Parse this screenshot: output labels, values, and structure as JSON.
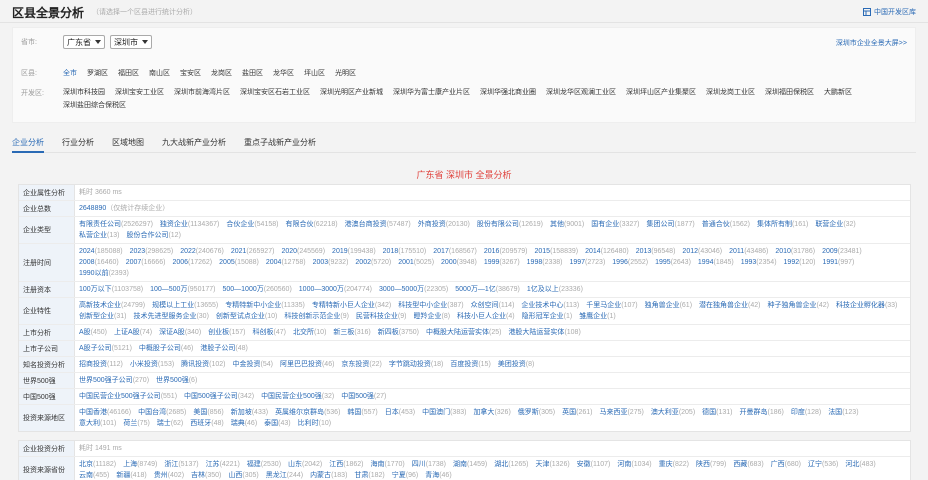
{
  "header": {
    "title": "区县全景分析",
    "subtitle": "（请选择一个区县进行统计分析）",
    "right_link": "中国开发区库"
  },
  "filter": {
    "province_label": "省市:",
    "province_value": "广东省",
    "city_value": "深圳市",
    "big_screen_link": "深圳市企业全景大屏>>",
    "district_label": "区县:",
    "districts": [
      "全市",
      "罗湖区",
      "福田区",
      "南山区",
      "宝安区",
      "龙岗区",
      "盐田区",
      "龙华区",
      "坪山区",
      "光明区"
    ],
    "zone_label": "开发区:",
    "zones": [
      "深圳市科技园",
      "深圳宝安工业区",
      "深圳市前海湾片区",
      "深圳宝安区石岩工业区",
      "深圳光明区产业新城",
      "深圳华为富士康产业片区",
      "深圳华强北商业圈",
      "深圳龙华区观澜工业区",
      "深圳坪山区产业集聚区",
      "深圳龙岗工业区",
      "深圳福田保税区",
      "大鹏新区",
      "深圳盐田综合保税区"
    ]
  },
  "tabs": [
    "企业分析",
    "行业分析",
    "区域地图",
    "九大战新产业分析",
    "重点子战新产业分析"
  ],
  "main_title": "广东省 深圳市 全景分析",
  "table1": {
    "rows": [
      {
        "label": "企业属性分析",
        "plain": "耗时 3660 ms",
        "items": []
      },
      {
        "label": "企业总数",
        "plain": "",
        "items": [
          {
            "t": "2648890",
            "c": "（仅统计存续企业）"
          }
        ]
      },
      {
        "label": "企业类型",
        "plain": "",
        "items": [
          {
            "t": "有限责任公司",
            "c": "(2526297)"
          },
          {
            "t": "独资企业",
            "c": "(1134367)"
          },
          {
            "t": "合伙企业",
            "c": "(54158)"
          },
          {
            "t": "有限合伙",
            "c": "(62218)"
          },
          {
            "t": "港澳台商投资",
            "c": "(57487)"
          },
          {
            "t": "外商投资",
            "c": "(20130)"
          },
          {
            "t": "股份有限公司",
            "c": "(12619)"
          },
          {
            "t": "其他",
            "c": "(9001)"
          },
          {
            "t": "国有企业",
            "c": "(3327)"
          },
          {
            "t": "集团公司",
            "c": "(1877)"
          },
          {
            "t": "普通合伙",
            "c": "(1562)"
          },
          {
            "t": "集体所有制",
            "c": "(161)"
          },
          {
            "t": "联营企业",
            "c": "(32)"
          },
          {
            "t": "私营企业",
            "c": "(13)"
          },
          {
            "t": "股份合作公司",
            "c": "(12)"
          }
        ]
      },
      {
        "label": "注册时间",
        "plain": "",
        "items": [
          {
            "t": "2024",
            "c": "(185088)"
          },
          {
            "t": "2023",
            "c": "(298625)"
          },
          {
            "t": "2022",
            "c": "(240676)"
          },
          {
            "t": "2021",
            "c": "(265927)"
          },
          {
            "t": "2020",
            "c": "(245569)"
          },
          {
            "t": "2019",
            "c": "(199438)"
          },
          {
            "t": "2018",
            "c": "(175510)"
          },
          {
            "t": "2017",
            "c": "(168567)"
          },
          {
            "t": "2016",
            "c": "(209579)"
          },
          {
            "t": "2015",
            "c": "(158839)"
          },
          {
            "t": "2014",
            "c": "(126480)"
          },
          {
            "t": "2013",
            "c": "(96548)"
          },
          {
            "t": "2012",
            "c": "(43046)"
          },
          {
            "t": "2011",
            "c": "(43486)"
          },
          {
            "t": "2010",
            "c": "(31786)"
          },
          {
            "t": "2009",
            "c": "(23481)"
          },
          {
            "t": "2008",
            "c": "(16460)"
          },
          {
            "t": "2007",
            "c": "(16666)"
          },
          {
            "t": "2006",
            "c": "(17262)"
          },
          {
            "t": "2005",
            "c": "(15088)"
          },
          {
            "t": "2004",
            "c": "(12758)"
          },
          {
            "t": "2003",
            "c": "(9232)"
          },
          {
            "t": "2002",
            "c": "(5720)"
          },
          {
            "t": "2001",
            "c": "(5025)"
          },
          {
            "t": "2000",
            "c": "(3948)"
          },
          {
            "t": "1999",
            "c": "(3267)"
          },
          {
            "t": "1998",
            "c": "(2338)"
          },
          {
            "t": "1997",
            "c": "(2723)"
          },
          {
            "t": "1996",
            "c": "(2552)"
          },
          {
            "t": "1995",
            "c": "(2643)"
          },
          {
            "t": "1994",
            "c": "(1845)"
          },
          {
            "t": "1993",
            "c": "(2354)"
          },
          {
            "t": "1992",
            "c": "(120)"
          },
          {
            "t": "1991",
            "c": "(997)"
          },
          {
            "t": "1990以前",
            "c": "(2393)"
          }
        ]
      },
      {
        "label": "注册资本",
        "plain": "",
        "items": [
          {
            "t": "100万以下",
            "c": "(1103758)"
          },
          {
            "t": "100—500万",
            "c": "(950177)"
          },
          {
            "t": "500—1000万",
            "c": "(260560)"
          },
          {
            "t": "1000—3000万",
            "c": "(204774)"
          },
          {
            "t": "3000—5000万",
            "c": "(22305)"
          },
          {
            "t": "5000万—1亿",
            "c": "(38679)"
          },
          {
            "t": "1亿及以上",
            "c": "(23336)"
          }
        ]
      },
      {
        "label": "企业特性",
        "plain": "",
        "items": [
          {
            "t": "高新技术企业",
            "c": "(24799)"
          },
          {
            "t": "规模以上工业",
            "c": "(13655)"
          },
          {
            "t": "专精特新中小企业",
            "c": "(11335)"
          },
          {
            "t": "专精特新小巨人企业",
            "c": "(342)"
          },
          {
            "t": "科技型中小企业",
            "c": "(387)"
          },
          {
            "t": "众创空间",
            "c": "(114)"
          },
          {
            "t": "企业技术中心",
            "c": "(113)"
          },
          {
            "t": "千里马企业",
            "c": "(107)"
          },
          {
            "t": "独角兽企业",
            "c": "(61)"
          },
          {
            "t": "潜在独角兽企业",
            "c": "(42)"
          },
          {
            "t": "种子独角兽企业",
            "c": "(42)"
          },
          {
            "t": "科技企业孵化器",
            "c": "(33)"
          },
          {
            "t": "创新型企业",
            "c": "(31)"
          },
          {
            "t": "技术先进型服务企业",
            "c": "(30)"
          },
          {
            "t": "创新型试点企业",
            "c": "(10)"
          },
          {
            "t": "科技创新示范企业",
            "c": "(9)"
          },
          {
            "t": "民营科技企业",
            "c": "(9)"
          },
          {
            "t": "瞪羚企业",
            "c": "(8)"
          },
          {
            "t": "科技小巨人企业",
            "c": "(4)"
          },
          {
            "t": "隐形冠军企业",
            "c": "(1)"
          },
          {
            "t": "雏鹰企业",
            "c": "(1)"
          }
        ]
      },
      {
        "label": "上市分析",
        "plain": "",
        "items": [
          {
            "t": "A股",
            "c": "(450)"
          },
          {
            "t": "上证A股",
            "c": "(74)"
          },
          {
            "t": "深证A股",
            "c": "(340)"
          },
          {
            "t": "创业板",
            "c": "(157)"
          },
          {
            "t": "科创板",
            "c": "(47)"
          },
          {
            "t": "北交所",
            "c": "(10)"
          },
          {
            "t": "新三板",
            "c": "(316)"
          },
          {
            "t": "新四板",
            "c": "(3750)"
          },
          {
            "t": "中概股大陆运营实体",
            "c": "(25)"
          },
          {
            "t": "港股大陆运营实体",
            "c": "(108)"
          }
        ]
      },
      {
        "label": "上市子公司",
        "plain": "",
        "items": [
          {
            "t": "A股子公司",
            "c": "(5121)"
          },
          {
            "t": "中概股子公司",
            "c": "(46)"
          },
          {
            "t": "港股子公司",
            "c": "(48)"
          }
        ]
      },
      {
        "label": "知名投资分析",
        "plain": "",
        "items": [
          {
            "t": "招商投资",
            "c": "(112)"
          },
          {
            "t": "小米投资",
            "c": "(153)"
          },
          {
            "t": "腾讯投资",
            "c": "(102)"
          },
          {
            "t": "中金投资",
            "c": "(54)"
          },
          {
            "t": "阿里巴巴投资",
            "c": "(46)"
          },
          {
            "t": "京东投资",
            "c": "(22)"
          },
          {
            "t": "字节跳动投资",
            "c": "(18)"
          },
          {
            "t": "百度投资",
            "c": "(15)"
          },
          {
            "t": "美团投资",
            "c": "(8)"
          }
        ]
      },
      {
        "label": "世界500强",
        "plain": "",
        "items": [
          {
            "t": "世界500强子公司",
            "c": "(270)"
          },
          {
            "t": "世界500强",
            "c": "(6)"
          }
        ]
      },
      {
        "label": "中国500强",
        "plain": "",
        "items": [
          {
            "t": "中国民营企业500强子公司",
            "c": "(551)"
          },
          {
            "t": "中国500强子公司",
            "c": "(342)"
          },
          {
            "t": "中国民营企业500强",
            "c": "(32)"
          },
          {
            "t": "中国500强",
            "c": "(27)"
          }
        ]
      },
      {
        "label": "投资来源地区",
        "plain": "",
        "items": [
          {
            "t": "中国香港",
            "c": "(46166)"
          },
          {
            "t": "中国台湾",
            "c": "(2685)"
          },
          {
            "t": "美国",
            "c": "(856)"
          },
          {
            "t": "新加坡",
            "c": "(433)"
          },
          {
            "t": "英属维尔京群岛",
            "c": "(536)"
          },
          {
            "t": "韩国",
            "c": "(557)"
          },
          {
            "t": "日本",
            "c": "(453)"
          },
          {
            "t": "中国澳门",
            "c": "(383)"
          },
          {
            "t": "加拿大",
            "c": "(326)"
          },
          {
            "t": "俄罗斯",
            "c": "(305)"
          },
          {
            "t": "英国",
            "c": "(261)"
          },
          {
            "t": "马来西亚",
            "c": "(275)"
          },
          {
            "t": "澳大利亚",
            "c": "(205)"
          },
          {
            "t": "德国",
            "c": "(131)"
          },
          {
            "t": "开曼群岛",
            "c": "(186)"
          },
          {
            "t": "印度",
            "c": "(128)"
          },
          {
            "t": "法国",
            "c": "(123)"
          },
          {
            "t": "意大利",
            "c": "(101)"
          },
          {
            "t": "荷兰",
            "c": "(75)"
          },
          {
            "t": "瑞士",
            "c": "(62)"
          },
          {
            "t": "西班牙",
            "c": "(48)"
          },
          {
            "t": "瑞典",
            "c": "(46)"
          },
          {
            "t": "泰国",
            "c": "(43)"
          },
          {
            "t": "比利时",
            "c": "(10)"
          }
        ]
      }
    ]
  },
  "table2": {
    "rows": [
      {
        "label": "企业投资分析",
        "plain": "耗时 1491 ms",
        "items": []
      },
      {
        "label": "投资来源省份",
        "plain": "",
        "items": [
          {
            "t": "北京",
            "c": "(11182)"
          },
          {
            "t": "上海",
            "c": "(8749)"
          },
          {
            "t": "浙江",
            "c": "(5137)"
          },
          {
            "t": "江苏",
            "c": "(4221)"
          },
          {
            "t": "福建",
            "c": "(2530)"
          },
          {
            "t": "山东",
            "c": "(2042)"
          },
          {
            "t": "江西",
            "c": "(1862)"
          },
          {
            "t": "海南",
            "c": "(1770)"
          },
          {
            "t": "四川",
            "c": "(1738)"
          },
          {
            "t": "湖南",
            "c": "(1459)"
          },
          {
            "t": "湖北",
            "c": "(1265)"
          },
          {
            "t": "天津",
            "c": "(1326)"
          },
          {
            "t": "安徽",
            "c": "(1107)"
          },
          {
            "t": "河南",
            "c": "(1034)"
          },
          {
            "t": "重庆",
            "c": "(822)"
          },
          {
            "t": "陕西",
            "c": "(799)"
          },
          {
            "t": "西藏",
            "c": "(683)"
          },
          {
            "t": "广西",
            "c": "(680)"
          },
          {
            "t": "辽宁",
            "c": "(536)"
          },
          {
            "t": "河北",
            "c": "(483)"
          },
          {
            "t": "云南",
            "c": "(455)"
          },
          {
            "t": "新疆",
            "c": "(418)"
          },
          {
            "t": "贵州",
            "c": "(402)"
          },
          {
            "t": "吉林",
            "c": "(350)"
          },
          {
            "t": "山西",
            "c": "(305)"
          },
          {
            "t": "黑龙江",
            "c": "(244)"
          },
          {
            "t": "内蒙古",
            "c": "(183)"
          },
          {
            "t": "甘肃",
            "c": "(182)"
          },
          {
            "t": "宁夏",
            "c": "(96)"
          },
          {
            "t": "青海",
            "c": "(46)"
          }
        ]
      }
    ]
  }
}
